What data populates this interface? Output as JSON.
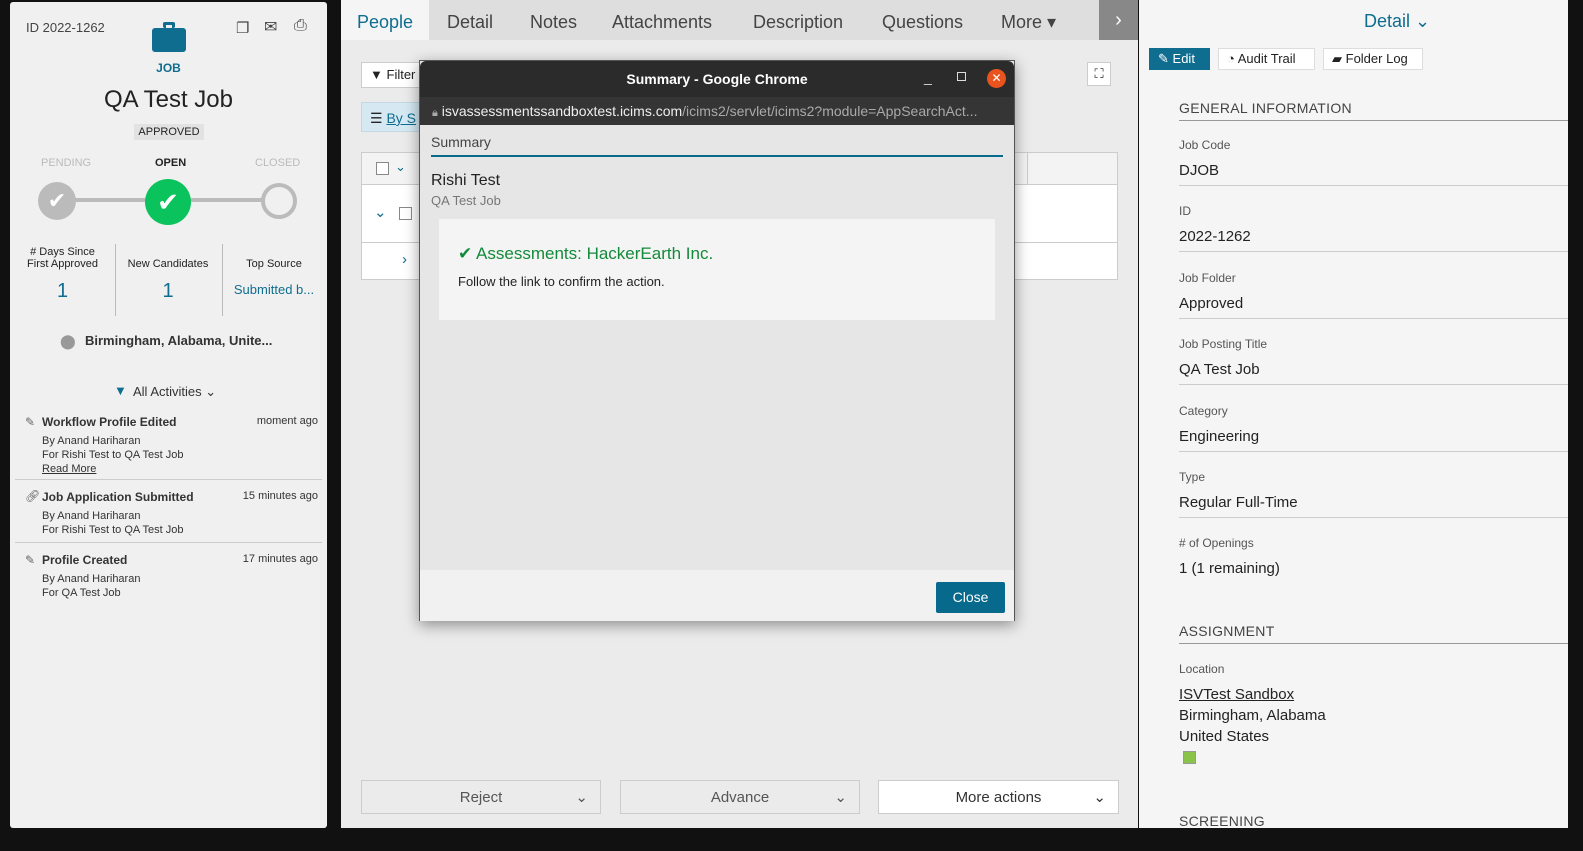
{
  "left": {
    "id_label": "ID 2022-1262",
    "type_label": "JOB",
    "title": "QA Test Job",
    "status_badge": "APPROVED",
    "stages": [
      "PENDING",
      "OPEN",
      "CLOSED"
    ],
    "stats": [
      {
        "label": "# Days Since First Approved",
        "value": "1"
      },
      {
        "label": "New Candidates",
        "value": "1"
      },
      {
        "label": "Top Source",
        "value": "Submitted b..."
      }
    ],
    "location": "Birmingham, Alabama, Unite...",
    "filter_label": "All Activities",
    "activities": [
      {
        "title": "Workflow Profile Edited",
        "time": "moment ago",
        "lines": [
          "By Anand Hariharan",
          "For Rishi Test to QA Test Job"
        ],
        "link": "Read More",
        "icon": "edit-icon"
      },
      {
        "title": "Job Application Submitted",
        "time": "15 minutes ago",
        "lines": [
          "By Anand Hariharan",
          "For Rishi Test to QA Test Job"
        ],
        "icon": "link-icon"
      },
      {
        "title": "Profile Created",
        "time": "17 minutes ago",
        "lines": [
          "By Anand Hariharan",
          "For QA Test Job"
        ],
        "icon": "edit-icon"
      }
    ]
  },
  "tabs": [
    "People",
    "Detail",
    "Notes",
    "Attachments",
    "Description",
    "Questions",
    "More"
  ],
  "mid": {
    "filter_label": "Filter",
    "by_label": "By S",
    "buttons": {
      "reject": "Reject",
      "advance": "Advance",
      "more_actions": "More actions"
    }
  },
  "popup": {
    "window_title": "Summary - Google Chrome",
    "url_host": "isvassessmentssandboxtest.icims.com",
    "url_path": "/icims2/servlet/icims2?module=AppSearchAct...",
    "section": "Summary",
    "person": "Rishi Test",
    "job": "QA Test Job",
    "message_title": "Assessments: HackerEarth Inc.",
    "message_body": "Follow the link to confirm the action.",
    "close_label": "Close",
    "accent": "#07698c",
    "success": "#138a3a"
  },
  "right": {
    "header": "Detail",
    "buttons": [
      "Edit",
      "Audit Trail",
      "Folder Log"
    ],
    "general_title": "GENERAL INFORMATION",
    "fields": [
      {
        "label": "Job Code",
        "value": "DJOB"
      },
      {
        "label": "ID",
        "value": "2022-1262"
      },
      {
        "label": "Job Folder",
        "value": "Approved"
      },
      {
        "label": "Job Posting Title",
        "value": "QA Test Job"
      },
      {
        "label": "Category",
        "value": "Engineering"
      },
      {
        "label": "Type",
        "value": "Regular Full-Time"
      },
      {
        "label": "# of Openings",
        "value": "1 (1 remaining)"
      }
    ],
    "assignment_title": "ASSIGNMENT",
    "location_label": "Location",
    "location_link": "ISVTest Sandbox",
    "location_lines": [
      "Birmingham, Alabama",
      "United States"
    ],
    "screening_title": "SCREENING"
  }
}
